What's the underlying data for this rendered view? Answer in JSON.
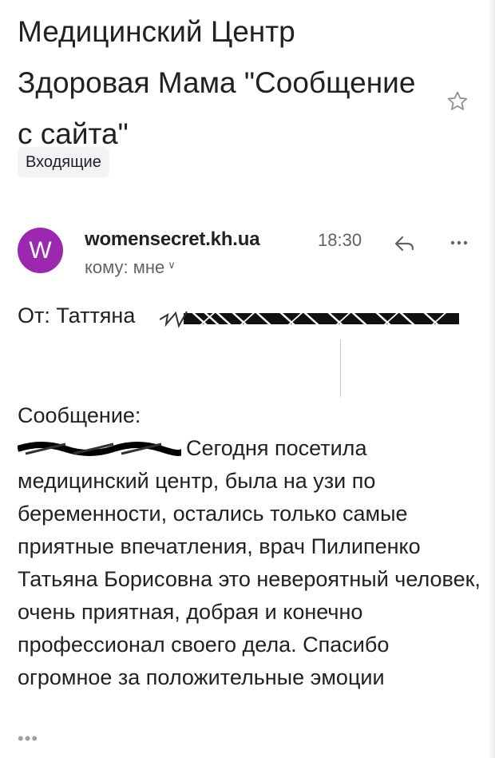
{
  "email": {
    "subject": "Медицинский Центр Здоровая Мама \"Сообщение с сайта\"",
    "label": "Входящие",
    "avatar_letter": "W",
    "avatar_color": "#9c27b0",
    "sender": "womensecret.kh.ua",
    "time": "18:30",
    "recipient": "кому: мне",
    "from_label": "От: Таттяна",
    "message_label": "Сообщение:",
    "message_text": "Сегодня посетила медицинский центр, была на узи по беременности, остались только самые приятные впечатления, врач Пилипенко Татьяна Борисовна это невероятный человек, очень приятная, добрая и конечно профессионал своего дела. Спасибо огромное за положительные эмоции",
    "collapsed": "•••"
  },
  "icons": {
    "star": "star-outline-icon",
    "reply": "reply-icon",
    "more": "more-horizontal-icon",
    "chevron": "chevron-down-icon"
  }
}
